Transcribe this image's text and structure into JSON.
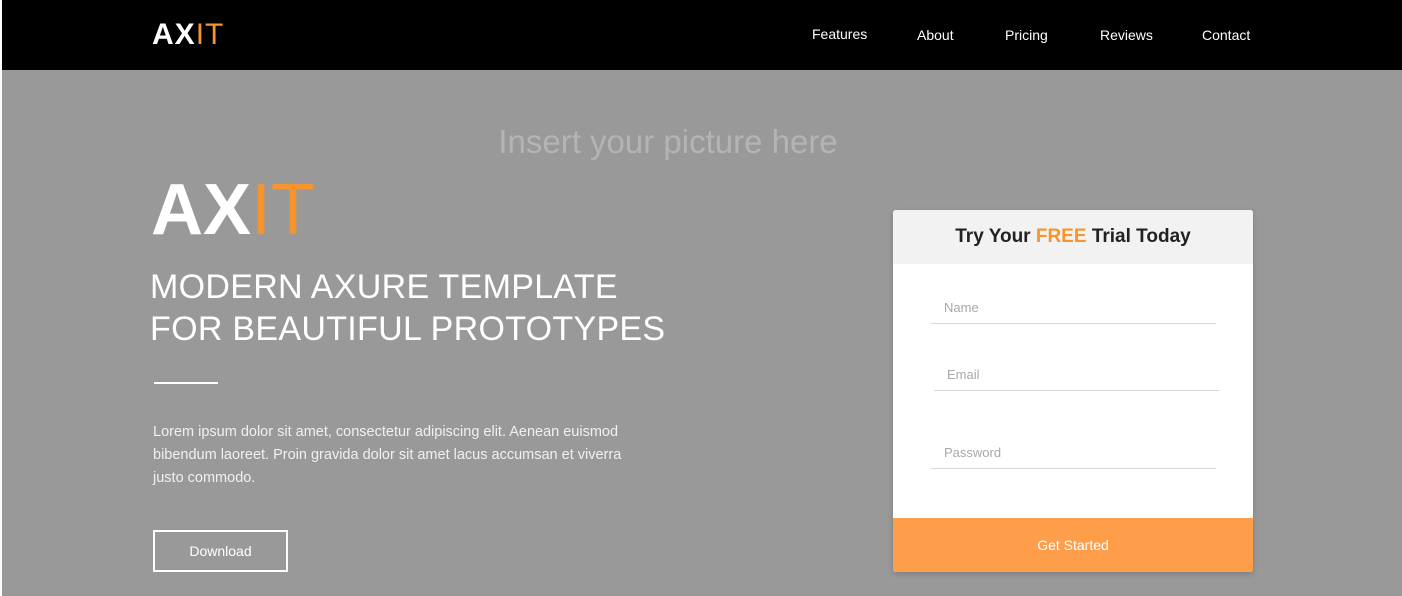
{
  "nav": {
    "logo": {
      "part1": "AX",
      "part2": "IT"
    },
    "items": [
      {
        "label": "Features"
      },
      {
        "label": "About"
      },
      {
        "label": "Pricing"
      },
      {
        "label": "Reviews"
      },
      {
        "label": "Contact"
      }
    ]
  },
  "hero": {
    "placeholder": "Insert your picture here",
    "logo": {
      "part1": "AX",
      "part2": "IT"
    },
    "headline_line1": "MODERN AXURE TEMPLATE",
    "headline_line2": "FOR BEAUTIFUL PROTOTYPES",
    "body": "Lorem ipsum dolor sit amet, consectetur adipiscing elit. Aenean euismod bibendum laoreet. Proin gravida dolor sit amet lacus accumsan et viverra justo commodo.",
    "download_label": "Download"
  },
  "trial_card": {
    "title_part1": "Try Your ",
    "title_highlight": "FREE",
    "title_part2": " Trial Today",
    "fields": {
      "name": {
        "placeholder": "Name",
        "value": ""
      },
      "email": {
        "placeholder": "Email",
        "value": ""
      },
      "password": {
        "placeholder": "Password",
        "value": ""
      }
    },
    "submit_label": "Get Started"
  },
  "colors": {
    "accent": "#f7942e",
    "button_accent": "#ff9e4a",
    "nav_background": "#000000",
    "hero_background": "#999999"
  }
}
